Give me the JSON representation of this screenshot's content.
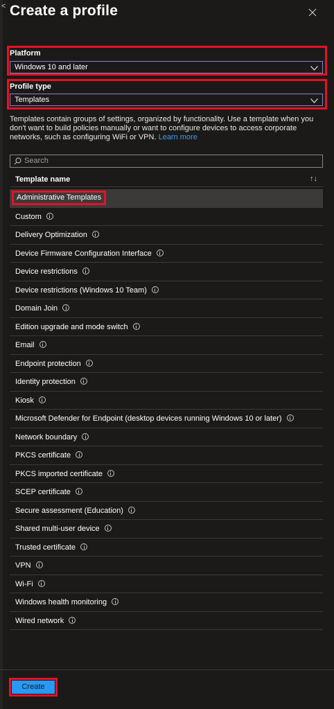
{
  "header": {
    "back_glyph": "<",
    "title": "Create a profile",
    "close_icon": "close-icon"
  },
  "platform": {
    "label": "Platform",
    "value": "Windows 10 and later"
  },
  "profile_type": {
    "label": "Profile type",
    "value": "Templates"
  },
  "description": {
    "text": "Templates contain groups of settings, organized by functionality. Use a template when you don't want to build policies manually or want to configure devices to access corporate networks, such as configuring WiFi or VPN. ",
    "link": "Learn more"
  },
  "search": {
    "placeholder": "Search"
  },
  "table": {
    "column_header": "Template name",
    "sort_glyph": "↑↓",
    "rows": [
      {
        "name": "Administrative Templates",
        "info": false,
        "selected": true
      },
      {
        "name": "Custom",
        "info": true
      },
      {
        "name": "Delivery Optimization",
        "info": true
      },
      {
        "name": "Device Firmware Configuration Interface",
        "info": true
      },
      {
        "name": "Device restrictions",
        "info": true
      },
      {
        "name": "Device restrictions (Windows 10 Team)",
        "info": true
      },
      {
        "name": "Domain Join",
        "info": true
      },
      {
        "name": "Edition upgrade and mode switch",
        "info": true
      },
      {
        "name": "Email",
        "info": true
      },
      {
        "name": "Endpoint protection",
        "info": true
      },
      {
        "name": "Identity protection",
        "info": true
      },
      {
        "name": "Kiosk",
        "info": true
      },
      {
        "name": "Microsoft Defender for Endpoint (desktop devices running Windows 10 or later)",
        "info": true
      },
      {
        "name": "Network boundary",
        "info": true
      },
      {
        "name": "PKCS certificate",
        "info": true
      },
      {
        "name": "PKCS imported certificate",
        "info": true
      },
      {
        "name": "SCEP certificate",
        "info": true
      },
      {
        "name": "Secure assessment (Education)",
        "info": true
      },
      {
        "name": "Shared multi-user device",
        "info": true
      },
      {
        "name": "Trusted certificate",
        "info": true
      },
      {
        "name": "VPN",
        "info": true
      },
      {
        "name": "Wi-Fi",
        "info": true
      },
      {
        "name": "Windows health monitoring",
        "info": true
      },
      {
        "name": "Wired network",
        "info": true
      }
    ]
  },
  "footer": {
    "create_label": "Create"
  },
  "colors": {
    "background": "#1b1a19",
    "highlight": "#e81123",
    "accent": "#2899f5",
    "link": "#3f9bf4"
  }
}
